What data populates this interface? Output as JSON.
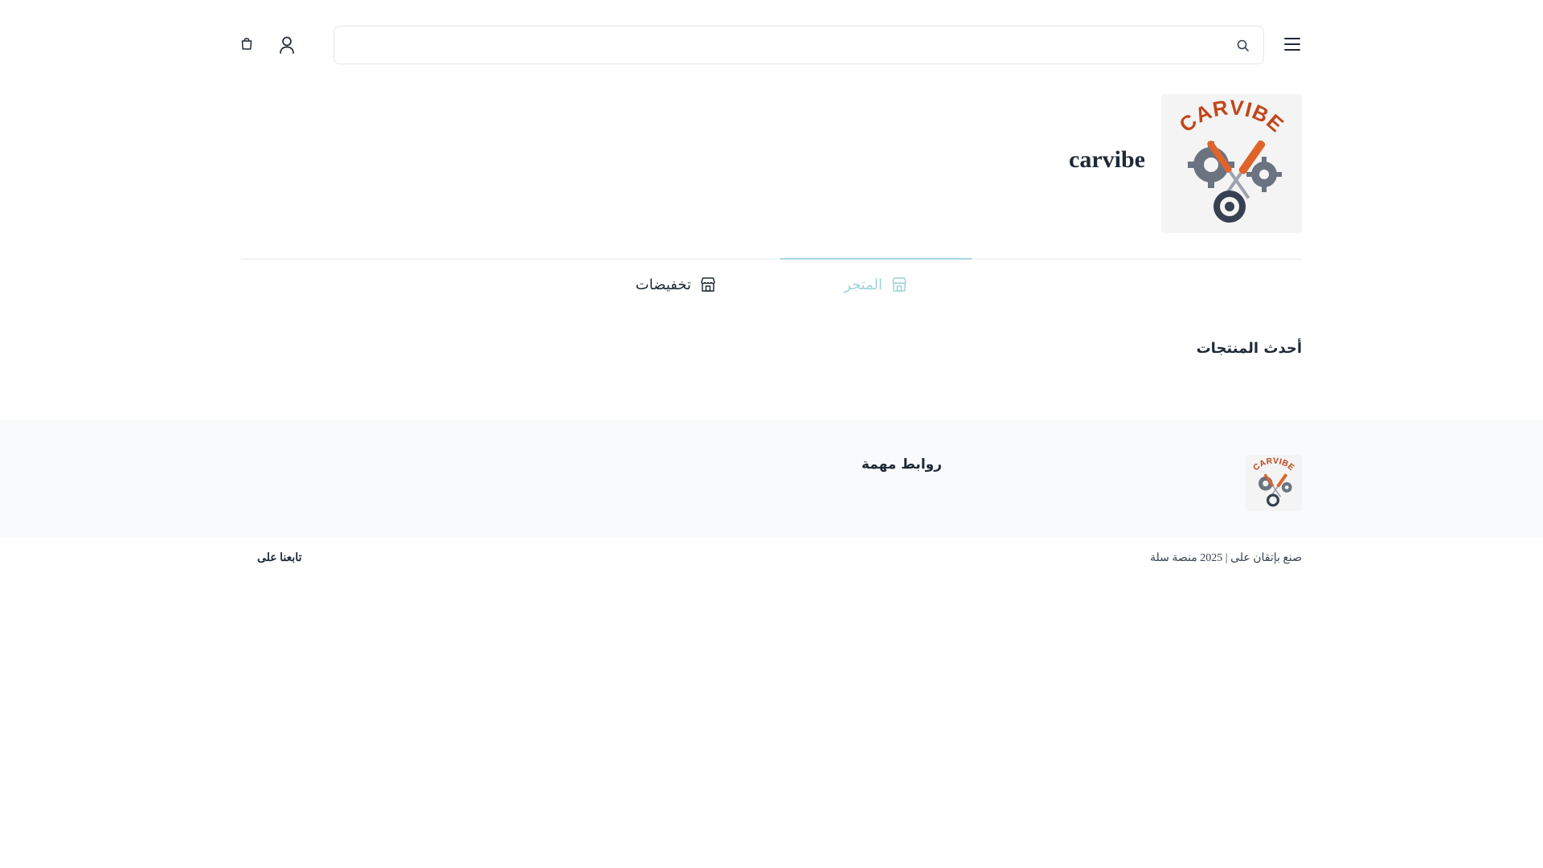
{
  "header": {
    "menu_icon": "hamburger-menu-icon",
    "search": {
      "placeholder": "",
      "value": "",
      "icon": "search-icon"
    },
    "user_icon": "user-icon",
    "cart_icon": "shopping-bag-icon"
  },
  "store": {
    "name": "carvibe",
    "logo_text": "CARVIBE"
  },
  "tabs": [
    {
      "label": "المتجر",
      "icon": "store-icon",
      "active": true
    },
    {
      "label": "تخفيضات",
      "icon": "store-icon",
      "active": false
    }
  ],
  "main": {
    "section_title": "أحدث المنتجات"
  },
  "footer": {
    "logo_text": "CARVIBE",
    "links_title": "روابط مهمة",
    "copyright": "صنع بإتقان على | 2025 منصة سلة",
    "follow_label": "تابعنا على"
  },
  "colors": {
    "accent": "#9fd2db",
    "accent_bar": "#a5d8e0",
    "text": "#1f2937",
    "footer_bg": "#f9fafb",
    "logo_orange": "#c2451c",
    "logo_gear": "#6b7280"
  }
}
